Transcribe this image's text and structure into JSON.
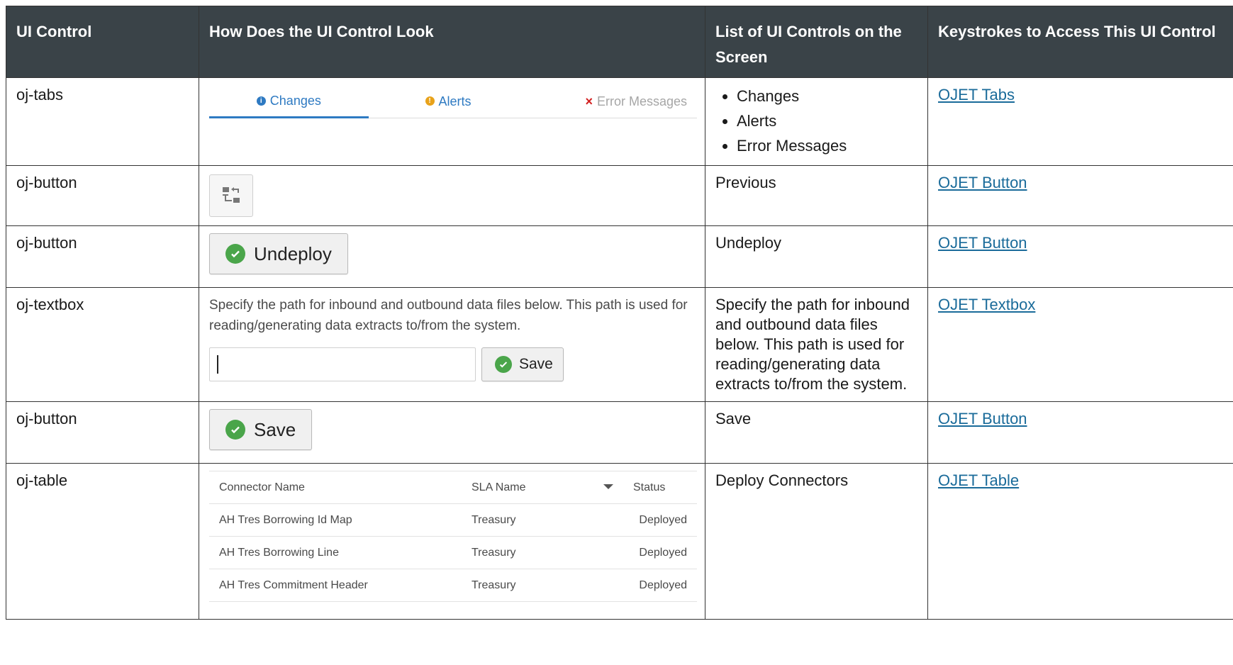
{
  "headers": {
    "ui_control": "UI Control",
    "look": "How Does the UI Control Look",
    "list": "List of UI Controls on the Screen",
    "keystrokes": "Keystrokes to Access This UI Control"
  },
  "rows": [
    {
      "control": "oj-tabs",
      "tabs": [
        {
          "label": "Changes",
          "icon": "info-icon"
        },
        {
          "label": "Alerts",
          "icon": "warning-icon"
        },
        {
          "label": "Error Messages",
          "icon": "error-x-icon"
        }
      ],
      "list_items": [
        "Changes",
        "Alerts",
        "Error Messages"
      ],
      "link": "OJET Tabs"
    },
    {
      "control": "oj-button",
      "icon": "previous-flow-icon",
      "list_text": "Previous",
      "link": "OJET Button"
    },
    {
      "control": "oj-button",
      "button_label": "Undeploy",
      "icon": "check-circle-icon",
      "list_text": "Undeploy",
      "link": "OJET Button"
    },
    {
      "control": "oj-textbox",
      "description": "Specify the path for inbound and outbound data files below. This path is used for reading/generating data extracts to/from the system.",
      "input_value": "",
      "save_label": "Save",
      "list_text": "Specify the path for inbound and outbound data files below. This path is used for reading/generating data extracts to/from the system.",
      "link": "OJET Textbox"
    },
    {
      "control": "oj-button",
      "button_label": "Save",
      "icon": "check-circle-icon",
      "list_text": "Save",
      "link": "OJET Button"
    },
    {
      "control": "oj-table",
      "table_headers": [
        "Connector Name",
        "SLA Name",
        "Status"
      ],
      "table_rows": [
        [
          "AH Tres Borrowing Id Map",
          "Treasury",
          "Deployed"
        ],
        [
          "AH Tres Borrowing Line",
          "Treasury",
          "Deployed"
        ],
        [
          "AH Tres Commitment Header",
          "Treasury",
          "Deployed"
        ]
      ],
      "list_text": "Deploy Connectors",
      "link": "OJET Table"
    }
  ],
  "colors": {
    "header_bg": "#3a4348",
    "link": "#1a6b9a",
    "tab_active": "#2e7ac2",
    "success_green": "#4aa54a",
    "error_red": "#d21e1e",
    "warning_orange": "#e8a21a"
  }
}
